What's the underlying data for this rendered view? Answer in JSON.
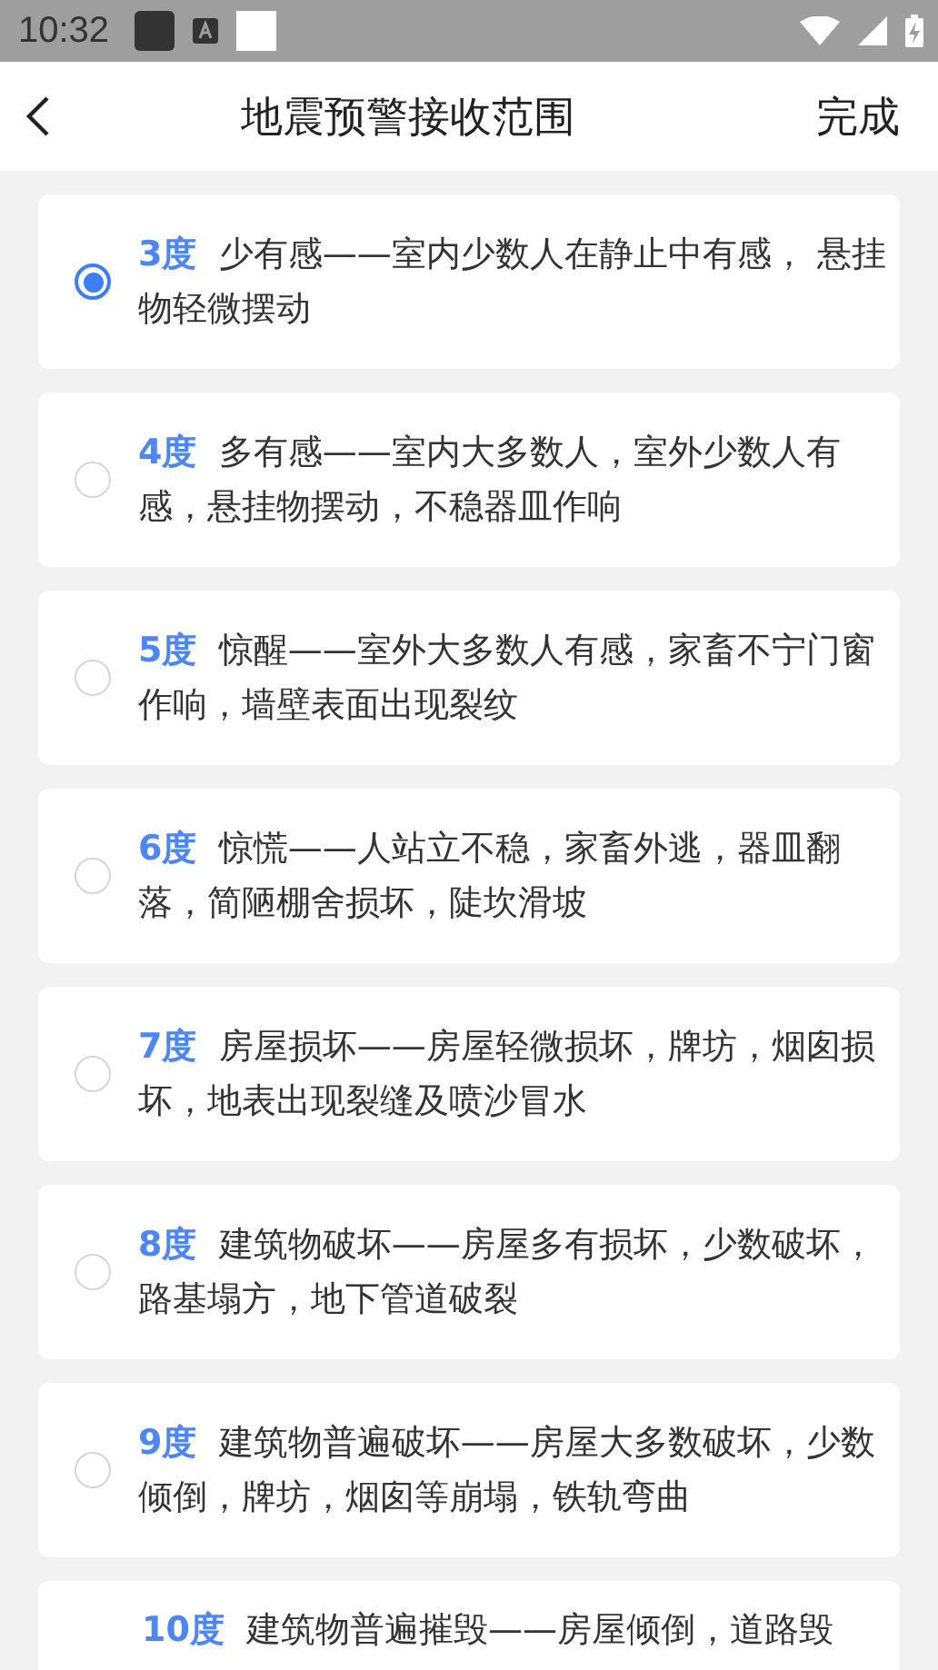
{
  "status_bar": {
    "time": "10:32"
  },
  "header": {
    "title": "地震预警接收范围",
    "done": "完成"
  },
  "options": [
    {
      "level": "3度",
      "text": "少有感——室内少数人在静止中有感， 悬挂物轻微摆动",
      "selected": true
    },
    {
      "level": "4度",
      "text": "多有感——室内大多数人，室外少数人有感，悬挂物摆动，不稳器皿作响",
      "selected": false
    },
    {
      "level": "5度",
      "text": "惊醒——室外大多数人有感，家畜不宁门窗作响，墙壁表面出现裂纹",
      "selected": false
    },
    {
      "level": "6度",
      "text": "惊慌——人站立不稳，家畜外逃，器皿翻落，简陋棚舍损坏，陡坎滑坡",
      "selected": false
    },
    {
      "level": "7度",
      "text": "房屋损坏——房屋轻微损坏，牌坊，烟囱损坏，地表出现裂缝及喷沙冒水",
      "selected": false
    },
    {
      "level": "8度",
      "text": "建筑物破坏——房屋多有损坏，少数破坏，路基塌方，地下管道破裂",
      "selected": false
    },
    {
      "level": "9度",
      "text": "建筑物普遍破坏——房屋大多数破坏，少数倾倒，牌坊，烟囱等崩塌，铁轨弯曲",
      "selected": false
    },
    {
      "level": "10度",
      "text": "建筑物普遍摧毁——房屋倾倒，道路毁"
    }
  ]
}
